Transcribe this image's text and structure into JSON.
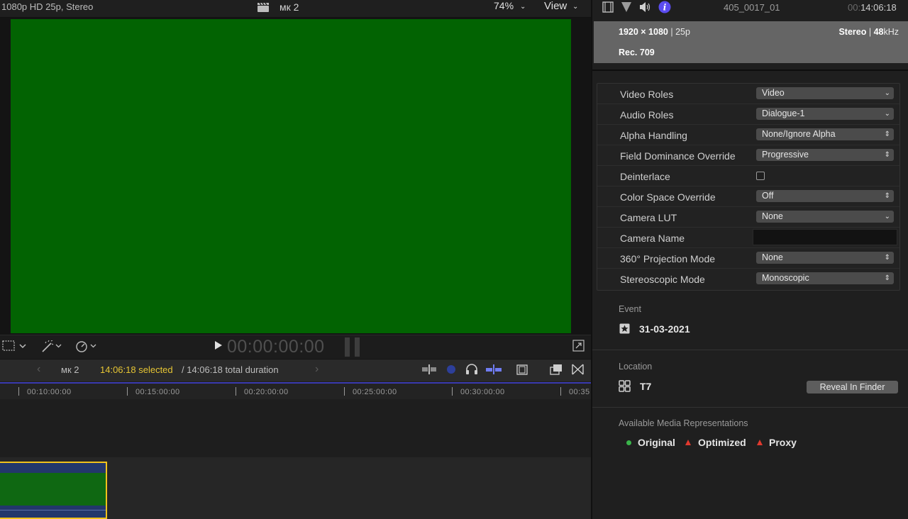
{
  "viewer": {
    "format_info": "1080p HD 25p, Stereo",
    "project_name": "мк 2",
    "zoom_level": "74%",
    "view_menu": "View",
    "timecode": "00:00:00:00"
  },
  "timeline": {
    "project_name": "мк 2",
    "selected": "14:06:18 selected",
    "total": " / 14:06:18 total duration",
    "ticks": [
      "00:10:00:00",
      "00:15:00:00",
      "00:20:00:00",
      "00:25:00:00",
      "00:30:00:00",
      "00:35"
    ]
  },
  "inspector": {
    "clip_name": "405_0017_01",
    "duration_dim": "00:",
    "duration": "14:06:18",
    "format": {
      "resolution": "1920 × 1080",
      "frame_rate": " | 25p",
      "audio_channels": "Stereo",
      "sample_rate_value": "48",
      "sample_rate_unit": "kHz",
      "color_space": "Rec. 709"
    },
    "settings": [
      {
        "label": "Video Roles",
        "value": "Video",
        "kind": "select-down"
      },
      {
        "label": "Audio Roles",
        "value": "Dialogue-1",
        "kind": "select-down"
      },
      {
        "label": "Alpha Handling",
        "value": "None/Ignore Alpha",
        "kind": "select-updown"
      },
      {
        "label": "Field Dominance Override",
        "value": "Progressive",
        "kind": "select-updown"
      },
      {
        "label": "Deinterlace",
        "value": "",
        "kind": "checkbox"
      },
      {
        "label": "Color Space Override",
        "value": "Off",
        "kind": "select-updown"
      },
      {
        "label": "Camera LUT",
        "value": "None",
        "kind": "select-down"
      },
      {
        "label": "Camera Name",
        "value": "",
        "kind": "text"
      },
      {
        "label": "360° Projection Mode",
        "value": "None",
        "kind": "select-updown"
      },
      {
        "label": "Stereoscopic Mode",
        "value": "Monoscopic",
        "kind": "select-updown"
      }
    ],
    "event": {
      "title": "Event",
      "date": "31-03-2021"
    },
    "location": {
      "title": "Location",
      "name": "T7",
      "reveal_label": "Reveal In Finder"
    },
    "media_representations": {
      "title": "Available Media Representations",
      "original": "Original",
      "optimized": "Optimized",
      "proxy": "Proxy"
    }
  },
  "colors": {
    "video_green": "#026302",
    "selection_yellow": "#e6c534",
    "info_blue": "#5b4cf0",
    "available_green": "#3ab54a",
    "missing_red": "#e0392e"
  }
}
